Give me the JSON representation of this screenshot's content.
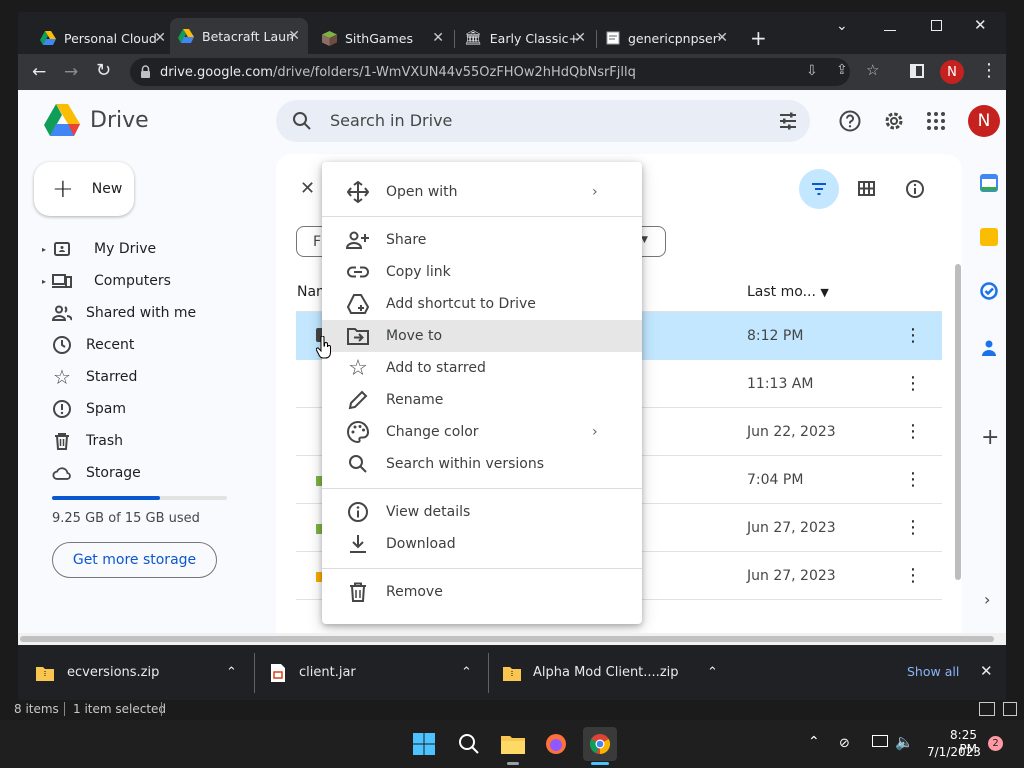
{
  "tabs": [
    {
      "title": "Personal Cloud",
      "icon": "google-drive-icon",
      "active": false
    },
    {
      "title": "Betacraft Launcher",
      "icon": "google-drive-icon",
      "active": true
    },
    {
      "title": "SithGames",
      "icon": "minecraft-block-icon",
      "active": false
    },
    {
      "title": "Early Classic+",
      "icon": "bank-icon",
      "active": false
    },
    {
      "title": "genericpnpserver",
      "icon": "page-icon",
      "active": false
    }
  ],
  "url": {
    "host": "drive.google.com",
    "path": "/drive/folders/1-WmVXUN44v55OzFHOw2hHdQbNsrFjllq"
  },
  "profile_initial": "N",
  "drive": {
    "logo_text": "Drive",
    "search_placeholder": "Search in Drive",
    "new_label": "New",
    "nav": [
      {
        "label": "My Drive",
        "icon": "my-drive-icon"
      },
      {
        "label": "Computers",
        "icon": "computers-icon"
      },
      {
        "label": "Shared with me",
        "icon": "shared-icon"
      },
      {
        "label": "Recent",
        "icon": "clock-icon"
      },
      {
        "label": "Starred",
        "icon": "star-icon"
      },
      {
        "label": "Spam",
        "icon": "spam-icon"
      },
      {
        "label": "Trash",
        "icon": "trash-icon"
      },
      {
        "label": "Storage",
        "icon": "cloud-icon"
      }
    ],
    "storage": {
      "used_text": "9.25 GB of 15 GB used",
      "fraction": 0.617,
      "button": "Get more storage"
    },
    "filter_chip": "F",
    "columns": {
      "name": "Nam",
      "modified": "Last mo..."
    },
    "rows": [
      {
        "date": "8:12 PM",
        "selected": true
      },
      {
        "date": "11:13 AM",
        "selected": false
      },
      {
        "date": "Jun 22, 2023",
        "selected": false
      },
      {
        "date": "7:04 PM",
        "selected": false
      },
      {
        "date": "Jun 27, 2023",
        "selected": false
      },
      {
        "date": "Jun 27, 2023",
        "selected": false
      }
    ]
  },
  "context_menu": {
    "groups": [
      [
        {
          "label": "Open with",
          "icon": "move-arrows-icon",
          "submenu": true
        }
      ],
      [
        {
          "label": "Share",
          "icon": "add-person-icon"
        },
        {
          "label": "Copy link",
          "icon": "link-icon"
        },
        {
          "label": "Add shortcut to Drive",
          "icon": "add-shortcut-icon"
        },
        {
          "label": "Move to",
          "icon": "move-to-icon",
          "highlighted": true
        },
        {
          "label": "Add to starred",
          "icon": "star-icon"
        },
        {
          "label": "Rename",
          "icon": "pencil-icon"
        },
        {
          "label": "Change color",
          "icon": "palette-icon",
          "submenu": true
        },
        {
          "label": "Search within versions",
          "icon": "search-icon"
        }
      ],
      [
        {
          "label": "View details",
          "icon": "info-icon"
        },
        {
          "label": "Download",
          "icon": "download-icon"
        }
      ],
      [
        {
          "label": "Remove",
          "icon": "trash-icon"
        }
      ]
    ]
  },
  "downloads": [
    {
      "name": "ecversions.zip",
      "icon": "zip-file-icon"
    },
    {
      "name": "client.jar",
      "icon": "jar-file-icon"
    },
    {
      "name": "Alpha Mod Client....zip",
      "icon": "zip-file-icon"
    }
  ],
  "downloads_show_all": "Show all",
  "status": {
    "items": "8 items",
    "selected": "1 item selected"
  },
  "taskbar": {
    "time": "8:25 PM",
    "date": "7/1/2023",
    "badge": "2"
  },
  "colors": {
    "accent": "#0b57d0",
    "selected_row": "#c2e7ff",
    "menu_highlight": "#e6e6e6",
    "avatar": "#c5221f"
  }
}
